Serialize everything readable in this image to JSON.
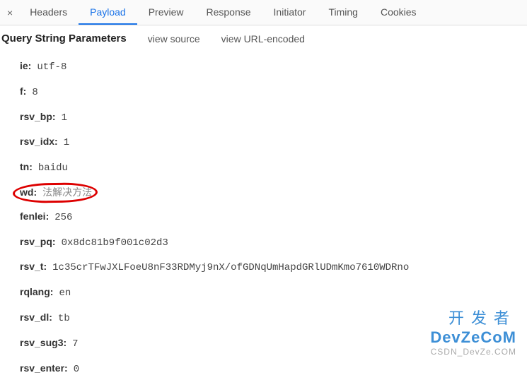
{
  "tabs": {
    "close": "×",
    "items": [
      {
        "label": "Headers",
        "active": false
      },
      {
        "label": "Payload",
        "active": true
      },
      {
        "label": "Preview",
        "active": false
      },
      {
        "label": "Response",
        "active": false
      },
      {
        "label": "Initiator",
        "active": false
      },
      {
        "label": "Timing",
        "active": false
      },
      {
        "label": "Cookies",
        "active": false
      }
    ]
  },
  "section": {
    "title": "Query String Parameters",
    "actions": [
      "view source",
      "view URL-encoded"
    ]
  },
  "params": [
    {
      "key": "ie:",
      "value": "utf-8",
      "highlighted": false
    },
    {
      "key": "f:",
      "value": "8",
      "highlighted": false
    },
    {
      "key": "rsv_bp:",
      "value": "1",
      "highlighted": false
    },
    {
      "key": "rsv_idx:",
      "value": "1",
      "highlighted": false
    },
    {
      "key": "tn:",
      "value": "baidu",
      "highlighted": false
    },
    {
      "key": "wd:",
      "value": "法解决方法",
      "highlighted": true
    },
    {
      "key": "fenlei:",
      "value": "256",
      "highlighted": false
    },
    {
      "key": "rsv_pq:",
      "value": "0x8dc81b9f001c02d3",
      "highlighted": false
    },
    {
      "key": "rsv_t:",
      "value": "1c35crTFwJXLFoeU8nF33RDMyj9nX/ofGDNqUmHapdGRlUDmKmo7610WDRno",
      "highlighted": false
    },
    {
      "key": "rqlang:",
      "value": "en",
      "highlighted": false
    },
    {
      "key": "rsv_dl:",
      "value": "tb",
      "highlighted": false
    },
    {
      "key": "rsv_sug3:",
      "value": "7",
      "highlighted": false
    },
    {
      "key": "rsv_enter:",
      "value": "0",
      "highlighted": false
    }
  ],
  "watermark": {
    "cn": "开发者",
    "en": "DevZeCoM",
    "sub": "CSDN_DevZe.COM"
  }
}
